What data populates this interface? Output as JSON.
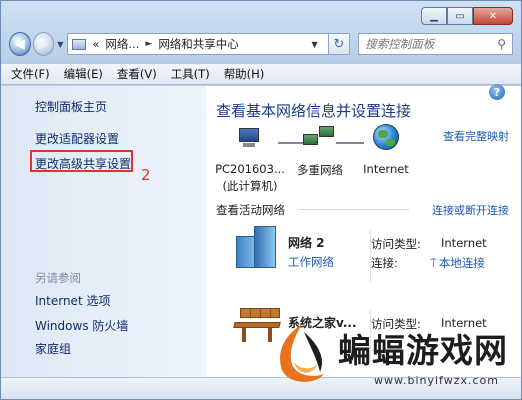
{
  "window": {
    "caption_buttons": {
      "minimize_icon": "minimize-icon",
      "maximize_icon": "maximize-icon",
      "close_icon": "close-icon"
    }
  },
  "nav": {
    "back_icon": "back-arrow-icon",
    "forward_icon": "forward-arrow-icon",
    "address": {
      "overflow": "«",
      "segments": [
        "网络...",
        "网络和共享中心"
      ],
      "separator": "►"
    },
    "refresh_icon": "refresh-icon",
    "search": {
      "placeholder": "搜索控制面板",
      "icon": "search-icon"
    }
  },
  "menubar": {
    "items": [
      "文件(F)",
      "编辑(E)",
      "查看(V)",
      "工具(T)",
      "帮助(H)"
    ]
  },
  "left_pane": {
    "home": "控制面板主页",
    "links": [
      "更改适配器设置",
      "更改高级共享设置"
    ],
    "annotation_number": "2",
    "see_also": {
      "title": "另请参阅",
      "links": [
        "Internet 选项",
        "Windows 防火墙",
        "家庭组"
      ]
    }
  },
  "main": {
    "title": "查看基本网络信息并设置连接",
    "full_map_link": "查看完整映射",
    "map": {
      "computer": {
        "name": "PC201603...",
        "subtitle": "(此计算机)"
      },
      "network": {
        "name": "多重网络"
      },
      "internet": {
        "name": "Internet"
      }
    },
    "active_networks": {
      "header": "查看活动网络",
      "connect_link": "连接或断开连接",
      "networks": [
        {
          "name": "网络  2",
          "type": "工作网络",
          "access_label": "访问类型:",
          "access_value": "Internet",
          "conn_label": "连接:",
          "conn_value": "本地连接"
        },
        {
          "name": "系统之家v...",
          "access_label": "访问类型:",
          "access_value": "Internet"
        }
      ]
    }
  },
  "watermark": {
    "title": "蝙蝠游戏网",
    "url": "www.binyifwzx.com"
  },
  "colors": {
    "link": "#1d59b5",
    "highlight": "#e0332b",
    "title_blue": "#1d3d86"
  }
}
